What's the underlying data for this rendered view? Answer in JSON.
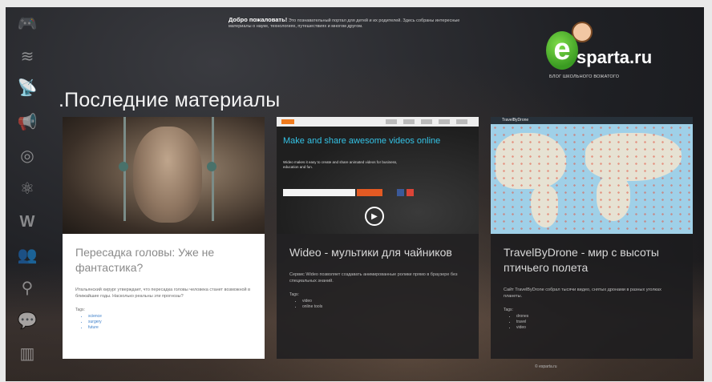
{
  "welcome": {
    "title": "Добро пожаловать!",
    "text": "Это познавательный портал для детей и их родителей. Здесь собраны интересные материалы о науке, технологиях, путешествиях и многом другом."
  },
  "logo": {
    "letter": "e",
    "name": "sparta.ru",
    "tagline": "БЛОГ ШКОЛЬНОГО ВОЖАТОГО"
  },
  "page_title": ".Последние материалы",
  "rail_icons": [
    {
      "name": "gamepad-icon",
      "glyph": "🎮"
    },
    {
      "name": "rank-chevrons-icon",
      "glyph": "≋"
    },
    {
      "name": "antenna-icon",
      "glyph": "📡"
    },
    {
      "name": "megaphone-icon",
      "glyph": "📢"
    },
    {
      "name": "cd-icon",
      "glyph": "◎"
    },
    {
      "name": "atom-icon",
      "glyph": "⚛"
    },
    {
      "name": "wordpress-icon",
      "glyph": "W"
    },
    {
      "name": "people-icon",
      "glyph": "👥"
    },
    {
      "name": "search-icon",
      "glyph": "⚲"
    },
    {
      "name": "chat-icon",
      "glyph": "💬"
    },
    {
      "name": "filmstrip-icon",
      "glyph": "▥"
    }
  ],
  "cards": [
    {
      "title": "Пересадка головы: Уже не фантастика?",
      "excerpt": "Итальянский хирург утверждает, что пересадка головы человека станет возможной в ближайшие годы. Насколько реальны эти прогнозы?",
      "tags_heading": "Tags:",
      "tags": [
        "science",
        "surgery",
        "future"
      ]
    },
    {
      "title": "Wideo - мультики для чайников",
      "excerpt": "Сервис Wideo позволяет создавать анимированные ролики прямо в браузере без специальных знаний.",
      "tags_heading": "Tags:",
      "tags": [
        "video",
        "online tools"
      ],
      "screenshot": {
        "hero": "Make and share awesome videos online",
        "sub": "Wideo makes it easy to create and share animated videos for business, education and fun."
      }
    },
    {
      "title": "TravelByDrone - мир с высоты птичьего полета",
      "excerpt": "Сайт TravelByDrone собрал тысячи видео, снятых дронами в разных уголках планеты.",
      "tags_heading": "Tags:",
      "tags": [
        "drones",
        "travel",
        "video"
      ],
      "screenshot": {
        "title": "TravelByDrone"
      }
    }
  ],
  "footer": "© esparta.ru"
}
